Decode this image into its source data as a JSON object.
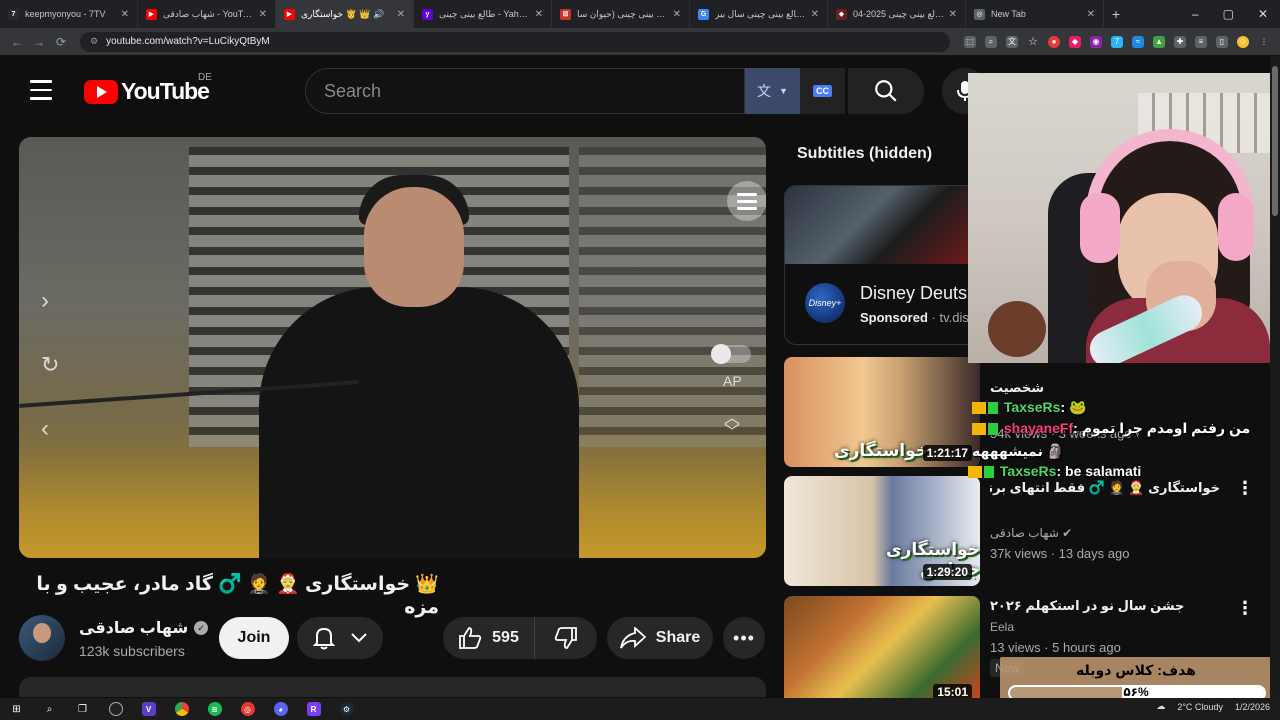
{
  "browser": {
    "tabs": [
      {
        "title": "keepmyonyou - 7TV",
        "favicon": "7",
        "color": "#2a2a2a"
      },
      {
        "title": "شهاب صادقی - YouTube",
        "favicon": "▶",
        "color": "#ff0000"
      },
      {
        "title": "خواستگاری 🤴 👑 🔊",
        "favicon": "▶",
        "color": "#ff0000",
        "active": true
      },
      {
        "title": "طالع بینی چینی - Yahoo Results",
        "favicon": "y",
        "color": "#6001d2"
      },
      {
        "title": "طالع بینی چینی (حیوان سا...",
        "favicon": "⊠",
        "color": "#c0392b"
      },
      {
        "title": "طالع بینی چینی سال ببر ...",
        "favicon": "G",
        "color": "#4285f4"
      },
      {
        "title": "طالع بینی چینی 2025-04...",
        "favicon": "◆",
        "color": "#6b1e1e"
      },
      {
        "title": "New Tab",
        "favicon": "◎",
        "color": "#5f6368"
      }
    ],
    "url": "youtube.com/watch?v=LuCikyQtByM",
    "window_controls": [
      "–",
      "▢",
      "✕"
    ],
    "extensions": [
      {
        "name": "screenshot-icon",
        "color": "#5f6368"
      },
      {
        "name": "zoom-icon",
        "color": "#5f6368"
      },
      {
        "name": "translate-icon",
        "color": "#5f6368"
      },
      {
        "name": "bookmark-star-icon",
        "color": "#5f6368"
      },
      {
        "name": "ext-red-icon",
        "color": "#e53935"
      },
      {
        "name": "ext-pink-icon",
        "color": "#e91e63"
      },
      {
        "name": "ext-purple-icon",
        "color": "#8e24aa"
      },
      {
        "name": "ext-7tv-icon",
        "color": "#29b6f6"
      },
      {
        "name": "ext-wave-icon",
        "color": "#1e88e5"
      },
      {
        "name": "ext-green-icon",
        "color": "#43a047"
      },
      {
        "name": "extensions-puzzle-icon",
        "color": "#5f6368"
      },
      {
        "name": "reading-list-icon",
        "color": "#5f6368"
      },
      {
        "name": "side-panel-icon",
        "color": "#5f6368"
      },
      {
        "name": "profile-avatar-icon",
        "color": "#fbc02d"
      },
      {
        "name": "chrome-menu-icon",
        "color": "#5f6368"
      }
    ]
  },
  "youtube": {
    "logo_text": "YouTube",
    "region": "DE",
    "search_placeholder": "Search",
    "cc_badge": "CC"
  },
  "player": {
    "autoplay_label": "AP"
  },
  "video": {
    "title": "👑 خواستگاری 🤶 🤵 ♂️ گاد مادر، عجیب و با مزه",
    "channel": "شهاب صادقی",
    "subscribers": "123k subscribers",
    "join_label": "Join",
    "likes": "595",
    "share_label": "Share"
  },
  "sidebar": {
    "subtitles_label": "Subtitles (hidden)",
    "ad": {
      "title": "Disney Deuts",
      "sponsored": "Sponsored",
      "domain": "· tv.dis",
      "logo_text": "Disney+"
    },
    "recommendations": [
      {
        "thumb_caption": "خواستگاری",
        "duration": "1:21:17",
        "title": "شخصیت",
        "channel": "",
        "stats": "54k views · 3 weeks ago",
        "new": false
      },
      {
        "thumb_caption": "خواستگاری جنتلمن",
        "duration": "1:29:20",
        "title": "خواستگاری 🤶 🤵 ♂️ فقط انتهای برنامه 😬",
        "channel": "شهاب صادقی ✔",
        "stats": "37k views · 13 days ago",
        "new": false
      },
      {
        "thumb_caption": "",
        "duration": "15:01",
        "title": "جشن سال نو در استکهلم ۲۰۲۶",
        "channel": "Eela",
        "stats": "13 views · 5 hours ago",
        "new": true,
        "new_label": "New"
      }
    ]
  },
  "stream_chat": [
    {
      "user": "TaxseRs",
      "msg": "",
      "badge": "crown",
      "kick": true
    },
    {
      "user": "shayaneFf",
      "msg": "من رفتم اومدم چرا تموم",
      "badge": "crown",
      "kick": true,
      "pink": true
    },
    {
      "user": "",
      "msg": "نمیشهههه 🗿",
      "badge": "",
      "kick": false
    },
    {
      "user": "TaxseRs",
      "msg": "be salamati",
      "badge": "crown",
      "kick": true
    }
  ],
  "goal": {
    "label": "هدف: کلاس دوبله",
    "percent_text": "۵۶%",
    "fraction": 0.56
  },
  "taskbar": {
    "weather": "2°C Cloudy",
    "date": "1/2/2026"
  }
}
